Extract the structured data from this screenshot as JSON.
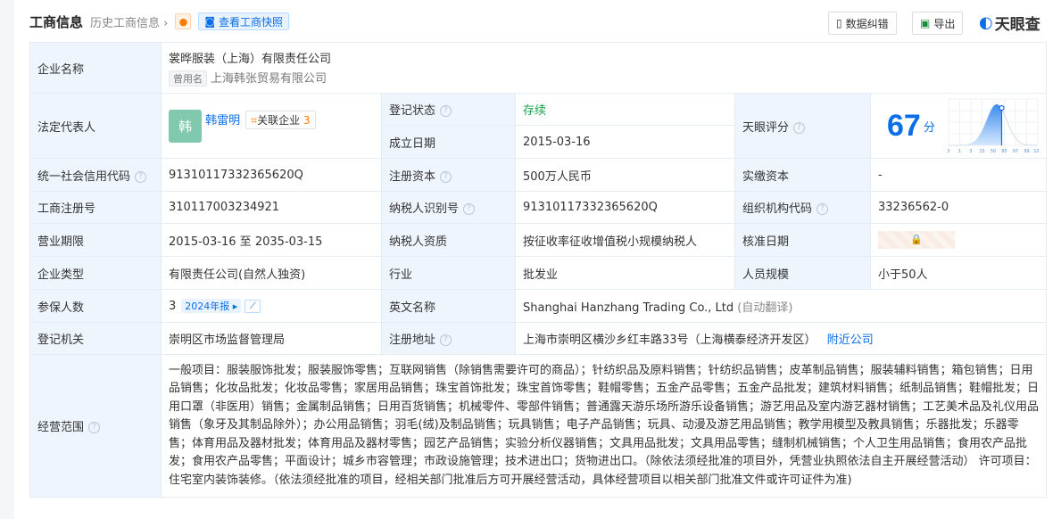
{
  "header": {
    "title": "工商信息",
    "history": "历史工商信息",
    "snapshot": "查看工商快照",
    "correct": "数据纠错",
    "export": "导出",
    "logo": "天眼查"
  },
  "company": {
    "name_label": "企业名称",
    "name": "裳晔服装（上海）有限责任公司",
    "former_tag": "曾用名",
    "former_name": "上海韩张贸易有限公司",
    "legal_label": "法定代表人",
    "legal_avatar": "韩",
    "legal_name": "韩雷明",
    "related_label": "关联企业",
    "related_count": "3",
    "status_label": "登记状态",
    "status": "存续",
    "found_label": "成立日期",
    "found": "2015-03-16",
    "score_label": "天眼评分",
    "score": "67",
    "score_unit": "分",
    "score_chart": {
      "ticks": [
        "0",
        "1",
        "3",
        "15",
        "50",
        "85",
        "97",
        "99",
        "100"
      ],
      "value": 67,
      "accent": "#0a6ee8"
    },
    "credit_label": "统一社会信用代码",
    "credit": "91310117332365620Q",
    "capital_label": "注册资本",
    "capital": "500万人民币",
    "paid_label": "实缴资本",
    "paid": "-",
    "reg_label": "工商注册号",
    "reg": "310117003234921",
    "taxid_label": "纳税人识别号",
    "taxid": "91310117332365620Q",
    "org_label": "组织机构代码",
    "org": "33236562-0",
    "term_label": "营业期限",
    "term": "2015-03-16 至 2035-03-15",
    "taxq_label": "纳税人资质",
    "taxq": "按征收率征收增值税小规模纳税人",
    "approve_label": "核准日期",
    "type_label": "企业类型",
    "type": "有限责任公司(自然人独资)",
    "industry_label": "行业",
    "industry": "批发业",
    "staff_label": "人员规模",
    "staff": "小于50人",
    "insured_label": "参保人数",
    "insured": "3",
    "insured_report": "2024年报",
    "en_label": "英文名称",
    "en": "Shanghai Hanzhang Trading Co., Ltd",
    "en_note": "(自动翻译)",
    "authority_label": "登记机关",
    "authority": "崇明区市场监督管理局",
    "addr_label": "注册地址",
    "addr": "上海市崇明区横沙乡红丰路33号（上海横泰经济开发区）",
    "nearby": "附近公司",
    "scope_label": "经营范围",
    "scope": "一般项目：服装服饰批发；服装服饰零售；互联网销售（除销售需要许可的商品）；针纺织品及原料销售；针纺织品销售；皮革制品销售；服装辅料销售；箱包销售；日用品销售；化妆品批发；化妆品零售；家居用品销售；珠宝首饰批发；珠宝首饰零售；鞋帽零售；五金产品零售；五金产品批发；建筑材料销售；纸制品销售；鞋帽批发；日用口罩（非医用）销售；金属制品销售；日用百货销售；机械零件、零部件销售；普通露天游乐场所游乐设备销售；游艺用品及室内游艺器材销售；工艺美术品及礼仪用品销售（象牙及其制品除外）；办公用品销售；羽毛(绒)及制品销售；玩具销售；电子产品销售；玩具、动漫及游艺用品销售；教学用模型及教具销售；乐器批发；乐器零售；体育用品及器材批发；体育用品及器材零售；园艺产品销售；实验分析仪器销售；文具用品批发；文具用品零售；缝制机械销售；个人卫生用品销售；食用农产品批发；食用农产品零售；平面设计；城乡市容管理；市政设施管理；技术进出口；货物进出口。（除依法须经批准的项目外，凭营业执照依法自主开展经营活动） 许可项目：住宅室内装饰装修。（依法须经批准的项目，经相关部门批准后方可开展经营活动，具体经营项目以相关部门批准文件或许可证件为准)"
  }
}
